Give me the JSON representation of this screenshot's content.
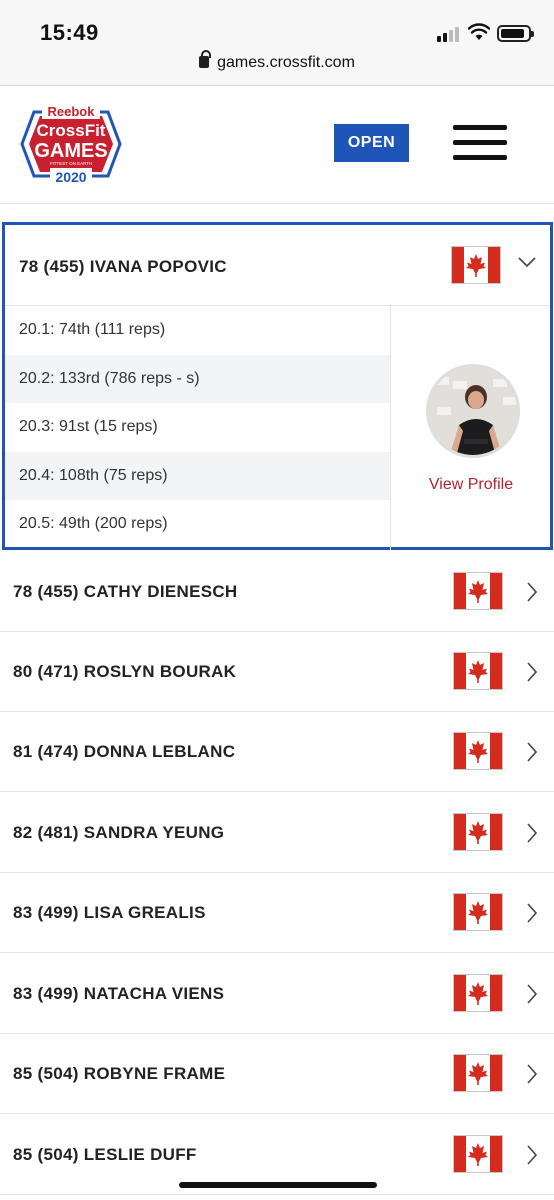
{
  "status_bar": {
    "time": "15:49",
    "signal_icon": "cellular-signal-icon",
    "wifi_icon": "wifi-icon",
    "battery_icon": "battery-icon",
    "battery_level": 0.9
  },
  "browser": {
    "url": "games.crossfit.com",
    "lock_icon": "lock-icon"
  },
  "header": {
    "logo": {
      "brand": "Reebok",
      "line1": "CrossFit",
      "line2": "GAMES",
      "tagline": "FITTEST ON EARTH",
      "year": "2020"
    },
    "open_label": "OPEN",
    "menu_icon": "hamburger-menu-icon"
  },
  "colors": {
    "accent_blue": "#1f55b6",
    "logo_red": "#c8202f",
    "profile_link_red": "#b5232f",
    "flag_red": "#d52b1e"
  },
  "expanded_athlete": {
    "label": "78  (455)  IVANA POPOVIC",
    "flag_icon": "canada-flag-icon",
    "chevron_icon": "chevron-down-icon",
    "scores": [
      "20.1: 74th (111 reps)",
      "20.2: 133rd (786 reps - s)",
      "20.3: 91st (15 reps)",
      "20.4: 108th (75 reps)",
      "20.5: 49th (200 reps)"
    ],
    "view_profile_label": "View Profile"
  },
  "athletes": [
    {
      "label": "78  (455)  CATHY DIENESCH"
    },
    {
      "label": "80  (471)  ROSLYN BOURAK"
    },
    {
      "label": "81  (474)  DONNA LEBLANC"
    },
    {
      "label": "82  (481)  SANDRA YEUNG"
    },
    {
      "label": "83  (499)  LISA GREALIS"
    },
    {
      "label": "83  (499)  NATACHA VIENS"
    },
    {
      "label": "85  (504)  ROBYNE FRAME"
    },
    {
      "label": "85  (504)  LESLIE DUFF"
    }
  ]
}
